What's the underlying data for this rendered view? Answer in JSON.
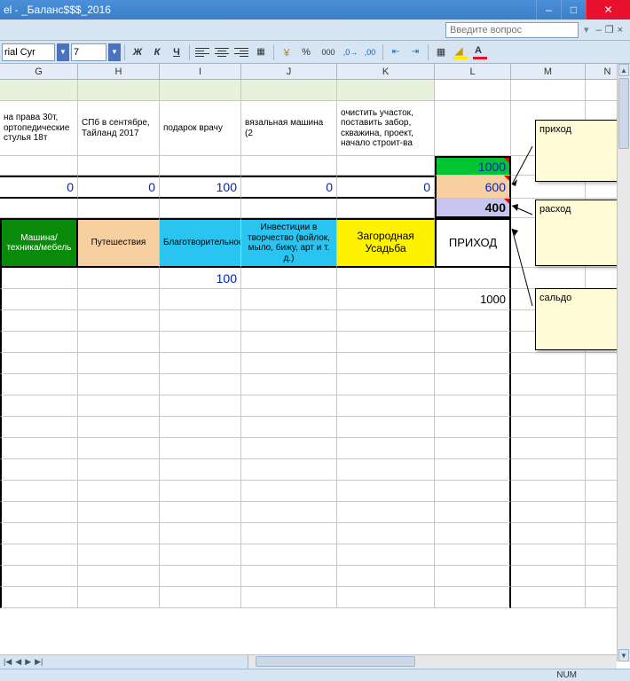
{
  "window": {
    "title": "el - _Баланс$$$_2016"
  },
  "menubar": {
    "question_placeholder": "Введите вопрос",
    "dash": "–",
    "restore": "❐",
    "close": "×"
  },
  "toolbar": {
    "font": "rial Cyr",
    "size": "7",
    "bold": "Ж",
    "italic": "К",
    "underline": "Ч",
    "percent": "%",
    "zeros": "000",
    "currency_glyph": "￥"
  },
  "columns": [
    "G",
    "H",
    "I",
    "J",
    "K",
    "L",
    "M",
    "N"
  ],
  "row_desc": {
    "G": "на права 30т, ортопедические стулья 18т",
    "H": "СПб в сентябре, Тайланд 2017",
    "I": "подарок врачу",
    "J": "вязальная машина (2",
    "K": "очистить участок, поставить забор, скважина, проект, начало строит-ва"
  },
  "row_green_L": "1000",
  "row_zeros": {
    "G": "0",
    "H": "0",
    "I": "100",
    "J": "0",
    "K": "0",
    "L": "600"
  },
  "row_saldo_L": "400",
  "categories": {
    "G": "Машина/техника/мебель",
    "H": "Путешествия",
    "I": "Благотворительность",
    "J": "Инвестиции в творчество (войлок, мыло, бижу, арт и т. д.)",
    "K": "Загородная Усадьба",
    "L": "ПРИХОД"
  },
  "row_val_I": "100",
  "row_total_L": "1000",
  "notes": {
    "a": "приход",
    "b": "расход",
    "c": "сальдо"
  },
  "status": {
    "num": "NUM"
  }
}
